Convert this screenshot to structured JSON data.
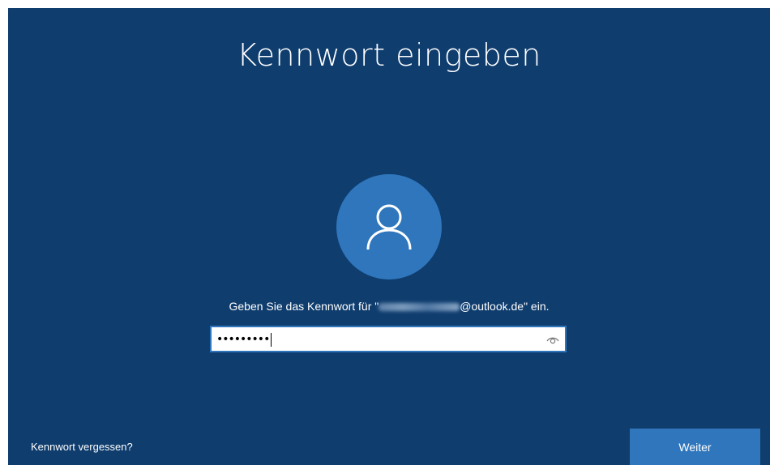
{
  "title": "Kennwort eingeben",
  "prompt": {
    "before": "Geben Sie das Kennwort für \"",
    "after": "@outlook.de\" ein."
  },
  "password": {
    "masked_value": "•••••••••"
  },
  "icons": {
    "avatar": "user-icon",
    "reveal": "eye-icon"
  },
  "links": {
    "forgot_password": "Kennwort vergessen?"
  },
  "buttons": {
    "next": "Weiter"
  },
  "colors": {
    "background": "#0f3d6e",
    "accent": "#2f76bd",
    "text": "#ffffff"
  }
}
